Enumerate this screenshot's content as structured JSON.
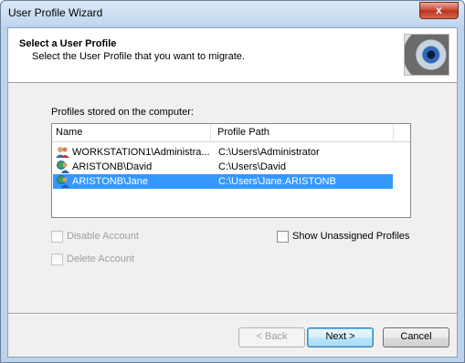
{
  "window": {
    "title": "User Profile Wizard",
    "close_label": "x"
  },
  "header": {
    "title": "Select a User Profile",
    "subtitle": "Select the User Profile that you want to migrate.",
    "graphic_icon": "eye-graphic-icon"
  },
  "profiles": {
    "group_label": "Profiles stored on the computer:",
    "columns": [
      "Name",
      "Profile Path"
    ],
    "rows": [
      {
        "name": "WORKSTATION1\\Administra...",
        "path": "C:\\Users\\Administrator",
        "icon": "admin-user-icon",
        "selected": false
      },
      {
        "name": "ARISTONB\\David",
        "path": "C:\\Users\\David",
        "icon": "domain-user-icon",
        "selected": false
      },
      {
        "name": "ARISTONB\\Jane",
        "path": "C:\\Users\\Jane.ARISTONB",
        "icon": "domain-user-icon",
        "selected": true
      }
    ]
  },
  "options": {
    "disable_account": {
      "label": "Disable Account",
      "checked": false,
      "enabled": false
    },
    "delete_account": {
      "label": "Delete Account",
      "checked": false,
      "enabled": false
    },
    "show_unassigned": {
      "label": "Show Unassigned Profiles",
      "checked": false,
      "enabled": true
    }
  },
  "buttons": {
    "back": "< Back",
    "next": "Next >",
    "cancel": "Cancel"
  },
  "colors": {
    "selection": "#3399ff",
    "title_bar": "#c4d7ef",
    "close_button": "#c7442d"
  }
}
